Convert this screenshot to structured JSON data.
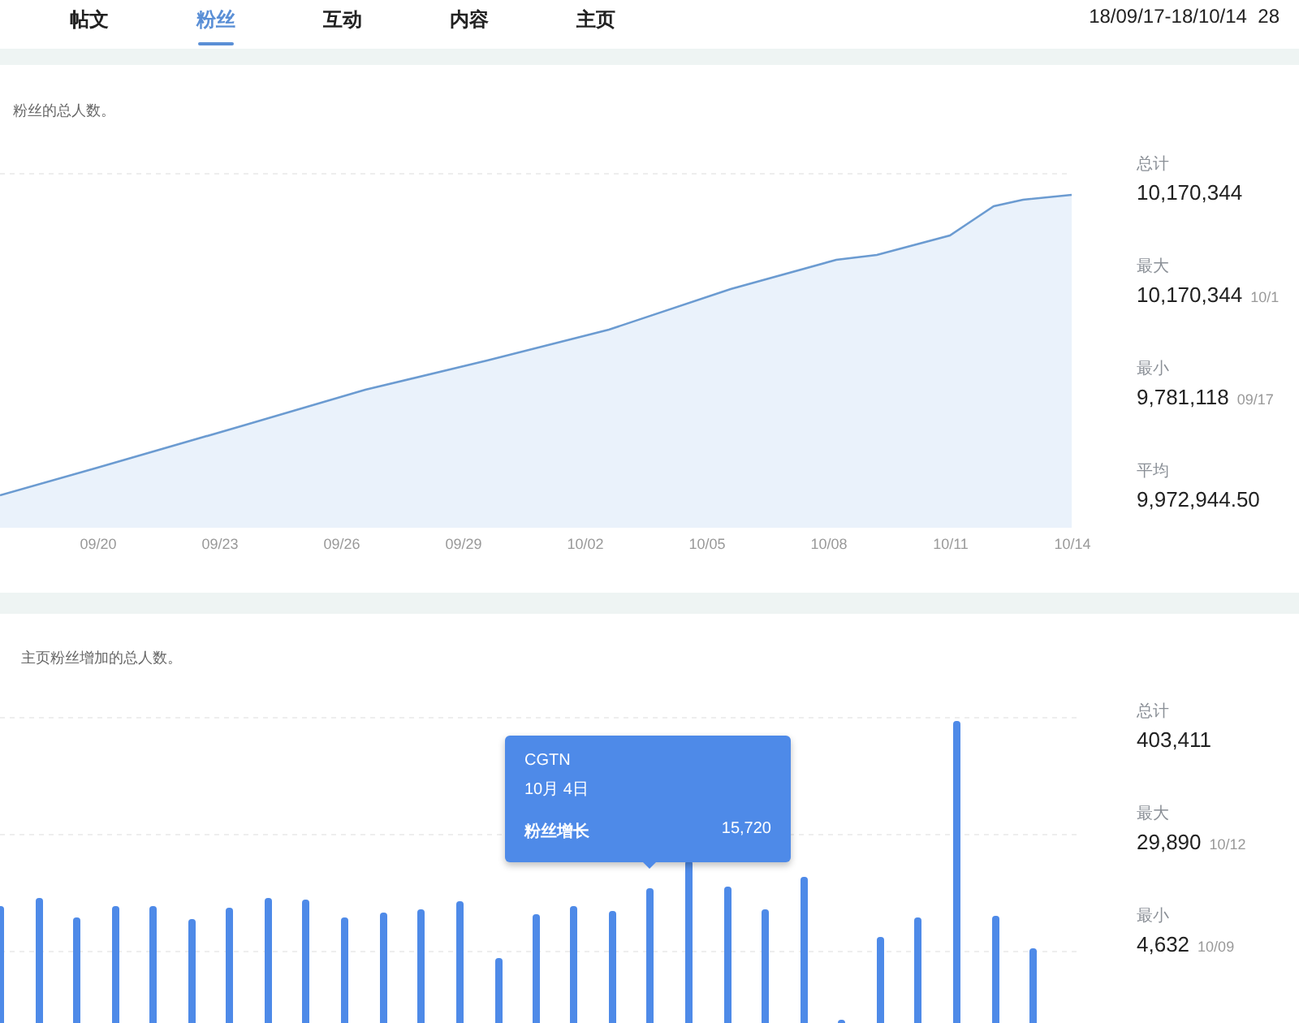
{
  "tabs": [
    {
      "label": "帖文",
      "selected": false
    },
    {
      "label": "粉丝",
      "selected": true
    },
    {
      "label": "互动",
      "selected": false
    },
    {
      "label": "内容",
      "selected": false
    },
    {
      "label": "主页",
      "selected": false
    }
  ],
  "date_range": "18/09/17-18/10/14  28",
  "sections": [
    {
      "subtitle": "粉丝的总人数。",
      "x_labels": [
        "09/20",
        "09/23",
        "09/26",
        "09/29",
        "10/02",
        "10/05",
        "10/08",
        "10/11",
        "10/14"
      ],
      "stats": [
        {
          "label": "总计",
          "value": "10,170,344"
        },
        {
          "label": "最大",
          "value": "10,170,344",
          "date": "10/1"
        },
        {
          "label": "最小",
          "value": "9,781,118",
          "date": "09/17"
        },
        {
          "label": "平均",
          "value": "9,972,944.50"
        }
      ]
    },
    {
      "subtitle": "主页粉丝增加的总人数。",
      "tooltip": {
        "title": "CGTN",
        "date": "10月 4日",
        "label": "粉丝增长",
        "value": "15,720"
      },
      "stats": [
        {
          "label": "总计",
          "value": "403,411"
        },
        {
          "label": "最大",
          "value": "29,890",
          "date": "10/12"
        },
        {
          "label": "最小",
          "value": "4,632",
          "date": "10/09"
        }
      ]
    }
  ]
}
